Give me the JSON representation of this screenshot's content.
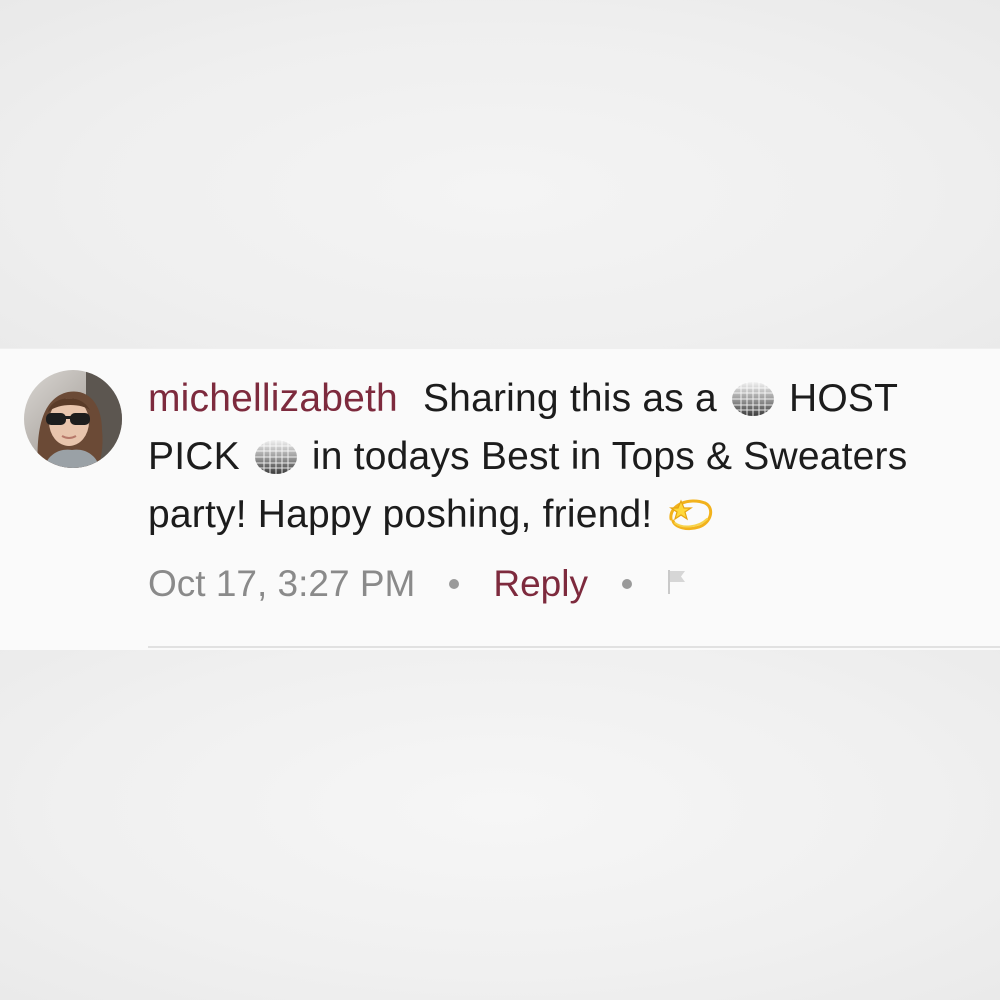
{
  "comment": {
    "username": "michellizabeth",
    "text_part1": "Sharing this as a",
    "text_part2": "HOST PICK",
    "text_part3": "in todays Best in Tops & Sweaters party! Happy poshing, friend!",
    "timestamp": "Oct 17, 3:27 PM",
    "reply_label": "Reply",
    "emoji_icons": [
      "disco-ball-icon",
      "disco-ball-icon",
      "dizzy-star-icon"
    ]
  },
  "colors": {
    "username": "#7d2a3d",
    "reply": "#7d2a3d",
    "timestamp": "#8a8a8a",
    "text": "#1c1c1c"
  }
}
